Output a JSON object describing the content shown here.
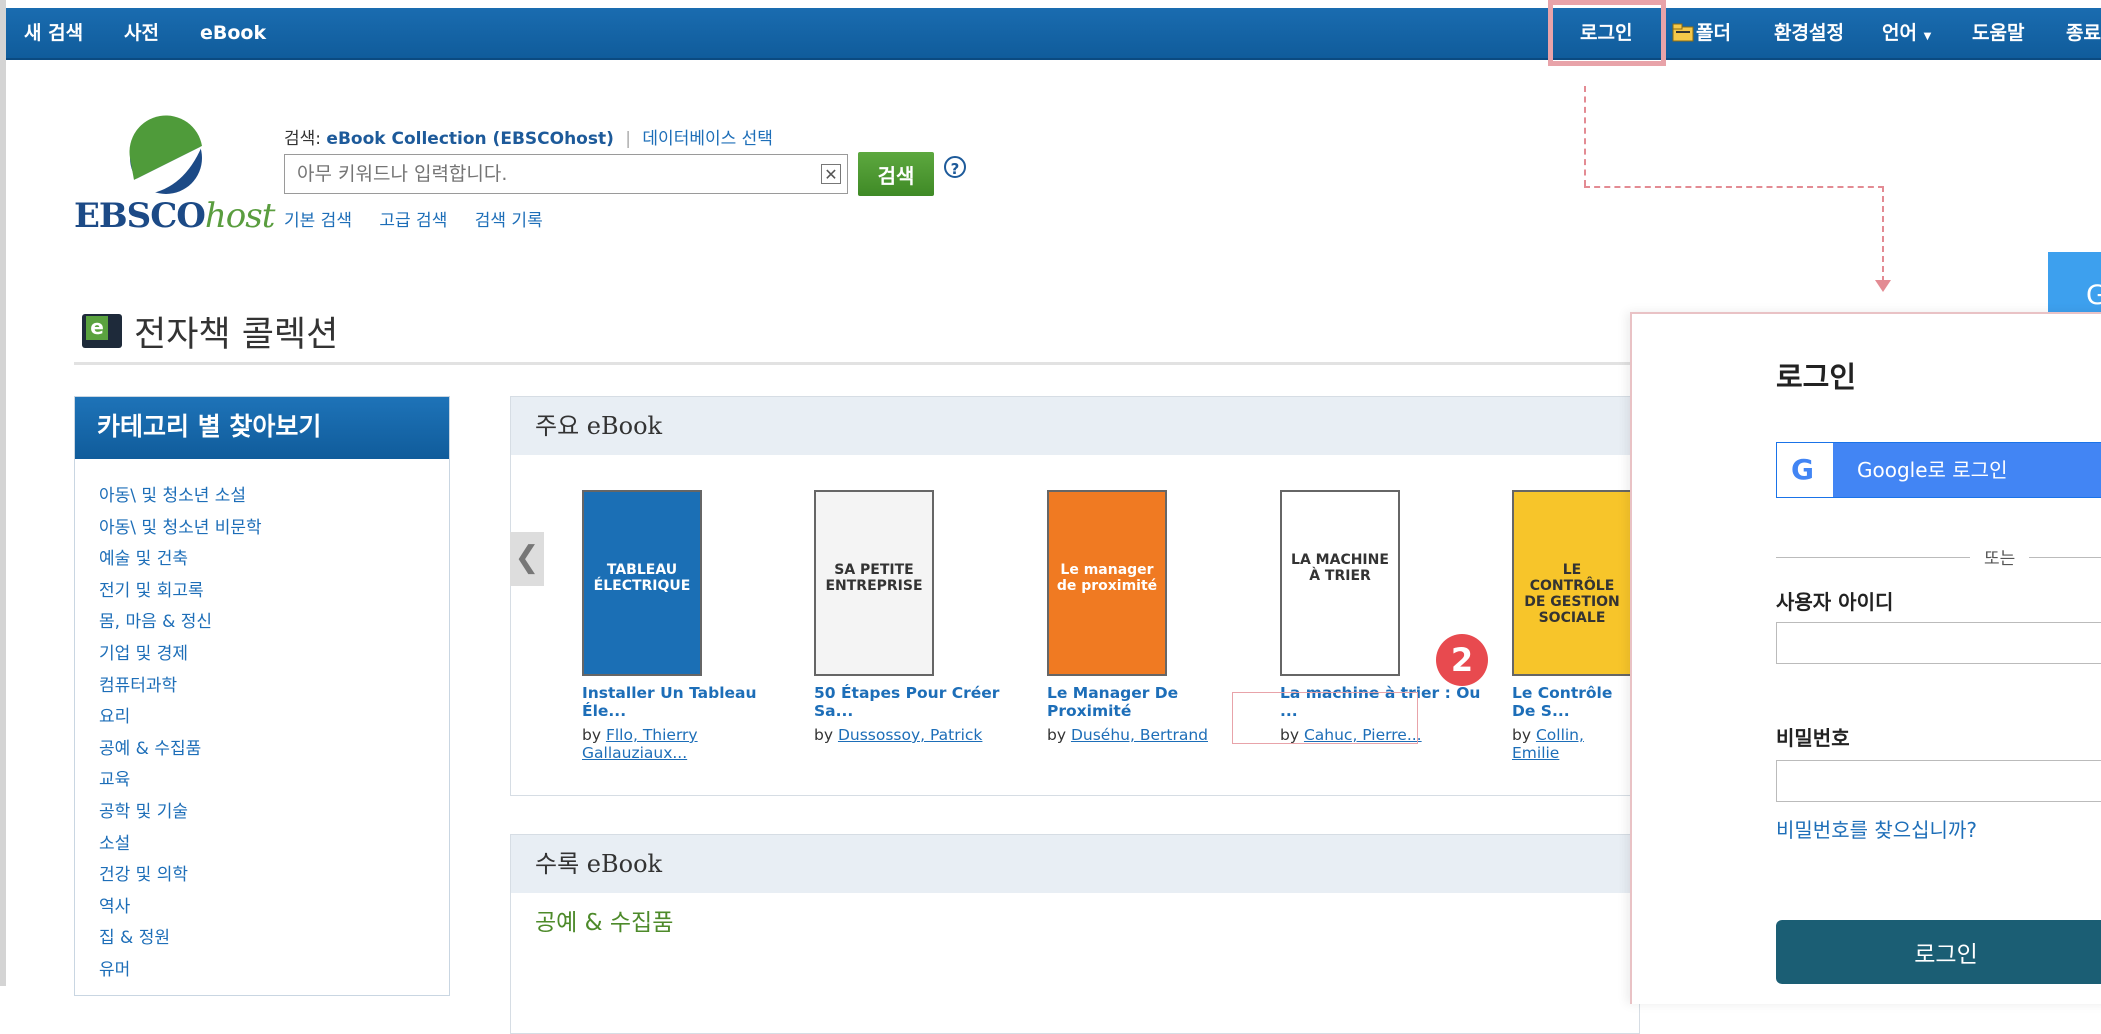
{
  "topnav": {
    "left": [
      "새 검색",
      "사전",
      "eBook"
    ],
    "right": [
      "로그인",
      "폴더",
      "환경설정",
      "언어",
      "도움말",
      "종료"
    ],
    "language_caret": "▼"
  },
  "logo": {
    "brand": "EBSCO",
    "brand_suffix": "host"
  },
  "search": {
    "prefix": "검색:",
    "database": "eBook Collection (EBSCOhost)",
    "separator": "|",
    "choose_db": "데이터베이스 선택",
    "placeholder": "아무 키워드나 입력합니다.",
    "clear": "✕",
    "button": "검색",
    "help": "?",
    "links": [
      "기본 검색",
      "고급 검색",
      "검색 기록"
    ]
  },
  "page": {
    "title": "전자책 콜렉션"
  },
  "sidebar": {
    "title": "카테고리 별 찾아보기",
    "items": [
      "아동\\ 및 청소년 소설",
      "아동\\ 및 청소년 비문학",
      "예술 및 건축",
      "전기 및 회고록",
      "몸, 마음 & 정신",
      "기업 및 경제",
      "컴퓨터과학",
      "요리",
      "공예 & 수집품",
      "교육",
      "공학 및 기술",
      "소설",
      "건강 및 의학",
      "역사",
      "집 & 정원",
      "유머"
    ]
  },
  "featured": {
    "title": "주요 eBook",
    "prev": "❮",
    "books": [
      {
        "title": "Installer Un Tableau Éle...",
        "by": "by",
        "author": "Fllo, Thierry Gallauziaux...",
        "cover_bg": "#1b6fb5",
        "cover_text": "TABLEAU ÉLECTRIQUE"
      },
      {
        "title": "50 Étapes Pour Créer Sa...",
        "by": "by",
        "author": "Dussossoy, Patrick",
        "cover_bg": "#f4f4f4",
        "cover_text": "SA PETITE ENTREPRISE"
      },
      {
        "title": "Le Manager De Proximité",
        "by": "by",
        "author": "Duséhu, Bertrand",
        "cover_bg": "#f07a22",
        "cover_text": "Le manager de proximité"
      },
      {
        "title": "La machine à trier : Ou ...",
        "by": "by",
        "author": "Cahuc, Pierre...",
        "cover_bg": "#ffffff",
        "cover_text": "LA MACHINE À TRIER"
      },
      {
        "title": "Le Contrôle De S...",
        "by": "by",
        "author": "Collin, Emilie",
        "cover_bg": "#f7c52a",
        "cover_text": "LE CONTRÔLE DE GESTION SOCIALE"
      }
    ]
  },
  "collected": {
    "title": "수록 eBook",
    "subtitle": "공예 & 수집품"
  },
  "annotation": {
    "badge": "2"
  },
  "login": {
    "title": "로그인",
    "google_label": "Google로 로그인",
    "google_g": "G",
    "or": "또는",
    "user_label": "사용자 아이디",
    "password_label": "비밀번호",
    "forgot": "비밀번호를 찾으십니까?",
    "submit": "로그인",
    "side_tab": "G"
  }
}
